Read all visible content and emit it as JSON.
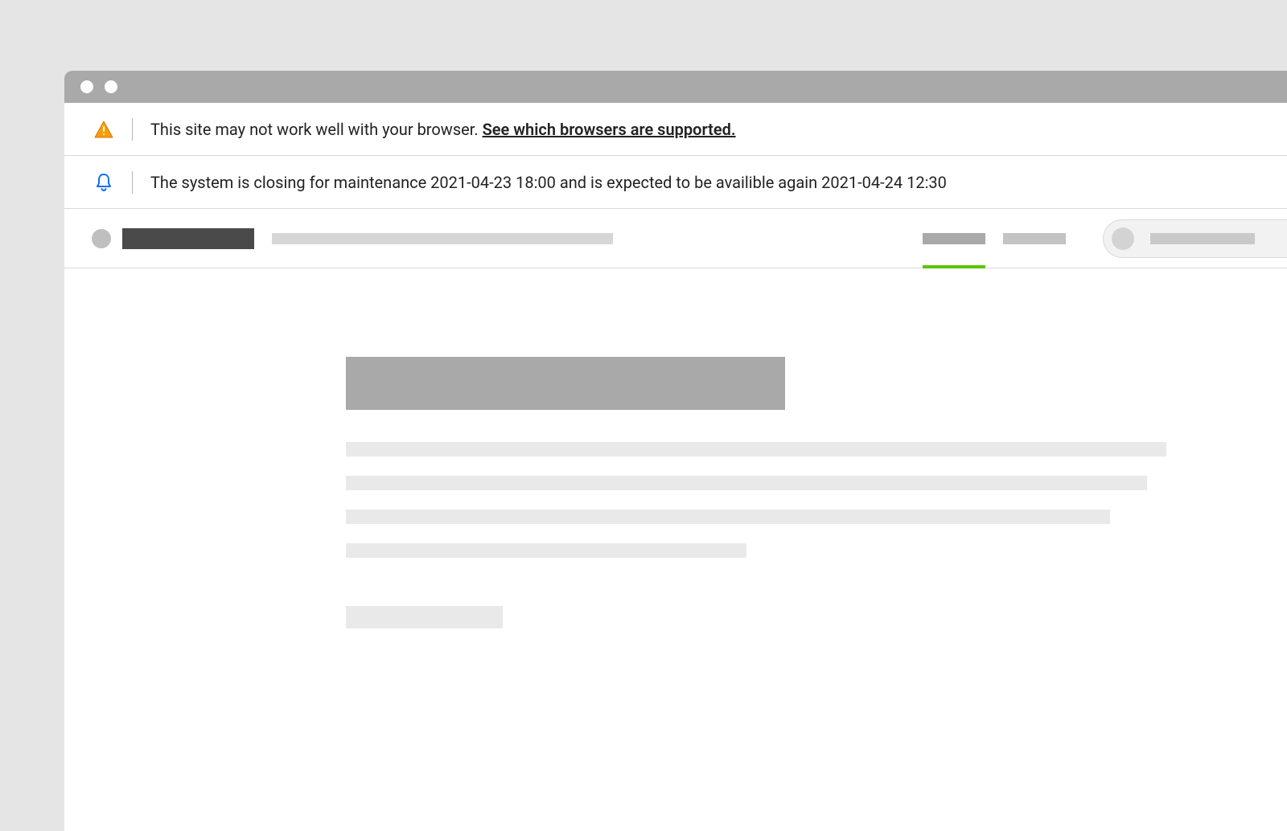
{
  "banners": {
    "browser_warning": {
      "text": "This site may not work well with your browser. ",
      "link_text": "See which browsers are supported."
    },
    "maintenance": {
      "text": "The system is closing for maintenance 2021-04-23 18:00 and is expected to be availible again 2021-04-24 12:30"
    }
  }
}
